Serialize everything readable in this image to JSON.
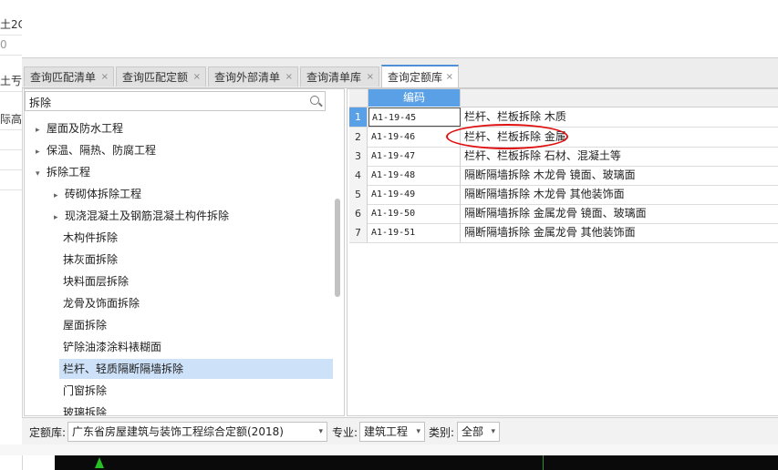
{
  "left_strip": [
    "土2C",
    "0",
    "土亐",
    "际高"
  ],
  "tabs": [
    {
      "label": "查询匹配清单"
    },
    {
      "label": "查询匹配定额"
    },
    {
      "label": "查询外部清单"
    },
    {
      "label": "查询清单库"
    },
    {
      "label": "查询定额库"
    }
  ],
  "tab_close": "×",
  "search": {
    "value": "拆除"
  },
  "tree": [
    {
      "label": "屋面及防水工程",
      "arrow": "▸"
    },
    {
      "label": "保温、隔热、防腐工程",
      "arrow": "▸"
    },
    {
      "label": "拆除工程",
      "arrow": "▾"
    },
    {
      "label": "砖砌体拆除工程",
      "arrow": "▸"
    },
    {
      "label": "现浇混凝土及钢筋混凝土构件拆除",
      "arrow": "▸"
    },
    {
      "label": "木构件拆除",
      "arrow": ""
    },
    {
      "label": "抹灰面拆除",
      "arrow": ""
    },
    {
      "label": "块料面层拆除",
      "arrow": ""
    },
    {
      "label": "龙骨及饰面拆除",
      "arrow": ""
    },
    {
      "label": "屋面拆除",
      "arrow": ""
    },
    {
      "label": "铲除油漆涂料裱糊面",
      "arrow": ""
    },
    {
      "label": "栏杆、轻质隔断隔墙拆除",
      "arrow": ""
    },
    {
      "label": "门窗拆除",
      "arrow": ""
    },
    {
      "label": "玻璃拆除",
      "arrow": ""
    }
  ],
  "grid": {
    "header_code": "编码",
    "rows": [
      {
        "n": "1",
        "code": "A1-19-45",
        "name": "栏杆、栏板拆除 木质"
      },
      {
        "n": "2",
        "code": "A1-19-46",
        "name": "栏杆、栏板拆除 金属"
      },
      {
        "n": "3",
        "code": "A1-19-47",
        "name": "栏杆、栏板拆除 石材、混凝土等"
      },
      {
        "n": "4",
        "code": "A1-19-48",
        "name": "隔断隔墙拆除 木龙骨 镜面、玻璃面"
      },
      {
        "n": "5",
        "code": "A1-19-49",
        "name": "隔断隔墙拆除 木龙骨 其他装饰面"
      },
      {
        "n": "6",
        "code": "A1-19-50",
        "name": "隔断隔墙拆除 金属龙骨 镜面、玻璃面"
      },
      {
        "n": "7",
        "code": "A1-19-51",
        "name": "隔断隔墙拆除 金属龙骨 其他装饰面"
      }
    ]
  },
  "filter": {
    "library_label": "定额库:",
    "library_value": "广东省房屋建筑与装饰工程综合定额(2018)",
    "major_label": "专业:",
    "major_value": "建筑工程",
    "category_label": "类别:",
    "category_value": "全部",
    "caret": "▾"
  },
  "colors": {
    "accent": "#5aa0e6",
    "highlight": "#e01010",
    "selected": "#cde1f8"
  }
}
